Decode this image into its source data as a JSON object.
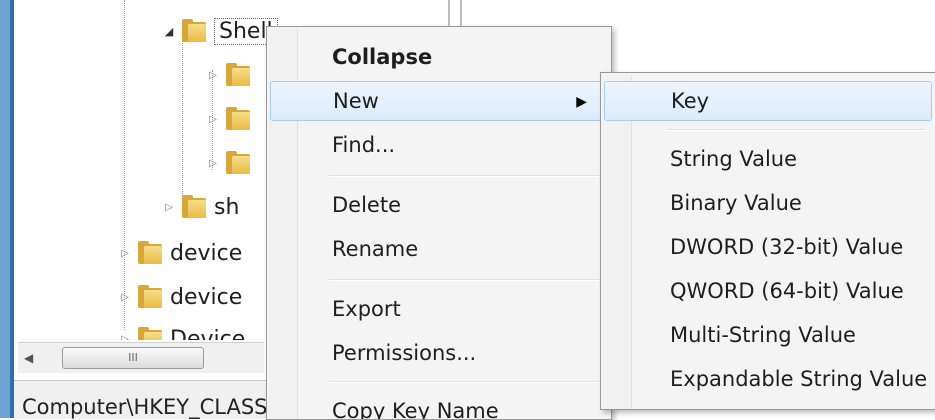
{
  "tree": {
    "nodes": [
      {
        "label": "Shell"
      },
      {
        "label": ""
      },
      {
        "label": ""
      },
      {
        "label": ""
      },
      {
        "label": "sh"
      },
      {
        "label": "device"
      },
      {
        "label": "device"
      },
      {
        "label": "Device"
      }
    ],
    "scrollbar_grip": "III"
  },
  "status_bar": {
    "path": "Computer\\HKEY_CLASSES_ROOT\\..."
  },
  "context_menu": {
    "items": [
      {
        "label": "Collapse"
      },
      {
        "label": "New"
      },
      {
        "label": "Find..."
      },
      {
        "label": "Delete"
      },
      {
        "label": "Rename"
      },
      {
        "label": "Export"
      },
      {
        "label": "Permissions..."
      },
      {
        "label": "Copy Key Name"
      }
    ]
  },
  "new_submenu": {
    "items": [
      {
        "label": "Key"
      },
      {
        "label": "String Value"
      },
      {
        "label": "Binary Value"
      },
      {
        "label": "DWORD (32-bit) Value"
      },
      {
        "label": "QWORD (64-bit) Value"
      },
      {
        "label": "Multi-String Value"
      },
      {
        "label": "Expandable String Value"
      }
    ]
  },
  "colors": {
    "accent": "#2f6fb0",
    "hover": "#dcebfb",
    "folder": "#e8bb44"
  }
}
